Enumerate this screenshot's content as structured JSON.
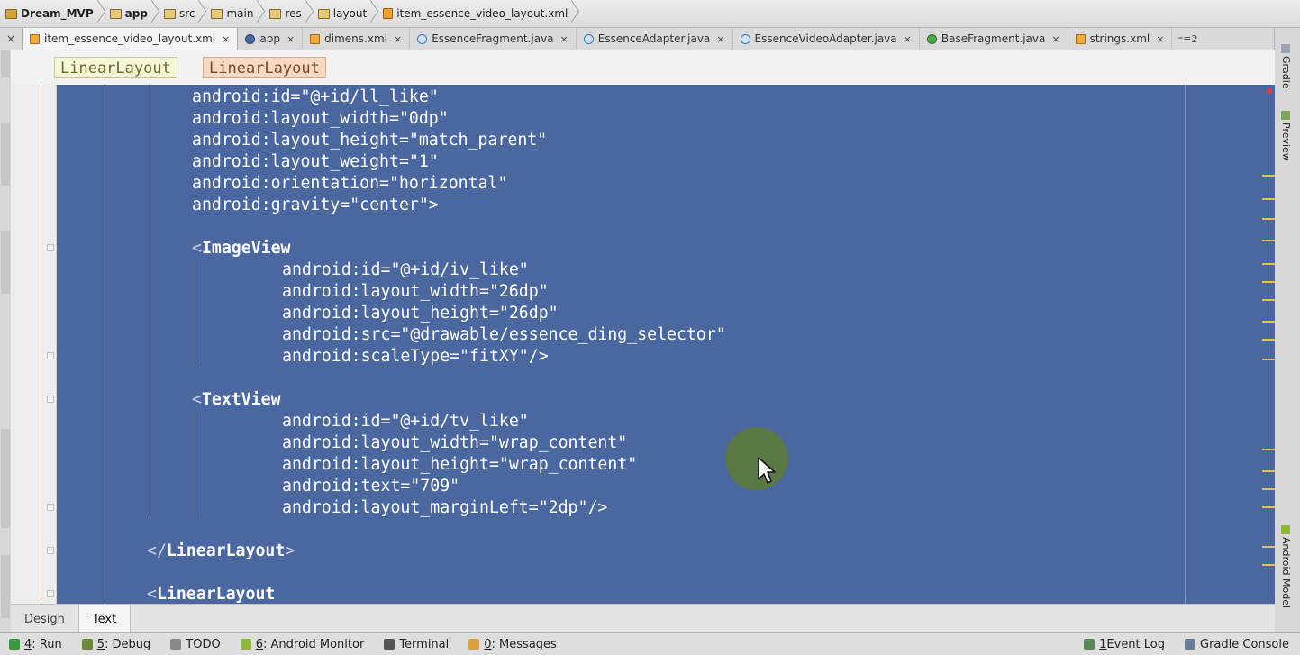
{
  "breadcrumb": [
    {
      "label": "Dream_MVP",
      "icon": "project-folder-icon",
      "bold": true
    },
    {
      "label": "app",
      "icon": "module-folder-icon",
      "bold": true
    },
    {
      "label": "src",
      "icon": "folder-icon",
      "bold": false
    },
    {
      "label": "main",
      "icon": "folder-icon",
      "bold": false
    },
    {
      "label": "res",
      "icon": "folder-icon",
      "bold": false
    },
    {
      "label": "layout",
      "icon": "folder-icon",
      "bold": false
    },
    {
      "label": "item_essence_video_layout.xml",
      "icon": "xml-file-icon",
      "bold": false
    }
  ],
  "tabs": [
    {
      "label": "item_essence_video_layout.xml",
      "type": "xml",
      "active": true
    },
    {
      "label": "app",
      "type": "app",
      "active": false
    },
    {
      "label": "dimens.xml",
      "type": "xml",
      "active": false
    },
    {
      "label": "EssenceFragment.java",
      "type": "class",
      "active": false
    },
    {
      "label": "EssenceAdapter.java",
      "type": "class",
      "active": false
    },
    {
      "label": "EssenceVideoAdapter.java",
      "type": "class",
      "active": false
    },
    {
      "label": "BaseFragment.java",
      "type": "base",
      "active": false
    },
    {
      "label": "strings.xml",
      "type": "xml",
      "active": false
    }
  ],
  "tab_close_glyph": "×",
  "tab_overflow": "⁼≡2",
  "tag_path": [
    "LinearLayout",
    "LinearLayout"
  ],
  "code_lines": [
    {
      "indent": 6,
      "text": "android:id=\"@+id/ll_like\""
    },
    {
      "indent": 6,
      "text": "android:layout_width=\"0dp\""
    },
    {
      "indent": 6,
      "text": "android:layout_height=\"match_parent\""
    },
    {
      "indent": 6,
      "text": "android:layout_weight=\"1\""
    },
    {
      "indent": 6,
      "text": "android:orientation=\"horizontal\""
    },
    {
      "indent": 6,
      "text": "android:gravity=\"center\">"
    },
    {
      "indent": 0,
      "text": ""
    },
    {
      "indent": 6,
      "text": "<ImageView"
    },
    {
      "indent": 10,
      "text": "android:id=\"@+id/iv_like\""
    },
    {
      "indent": 10,
      "text": "android:layout_width=\"26dp\""
    },
    {
      "indent": 10,
      "text": "android:layout_height=\"26dp\""
    },
    {
      "indent": 10,
      "text": "android:src=\"@drawable/essence_ding_selector\""
    },
    {
      "indent": 10,
      "text": "android:scaleType=\"fitXY\"/>"
    },
    {
      "indent": 0,
      "text": ""
    },
    {
      "indent": 6,
      "text": "<TextView"
    },
    {
      "indent": 10,
      "text": "android:id=\"@+id/tv_like\""
    },
    {
      "indent": 10,
      "text": "android:layout_width=\"wrap_content\""
    },
    {
      "indent": 10,
      "text": "android:layout_height=\"wrap_content\""
    },
    {
      "indent": 10,
      "text": "android:text=\"709\""
    },
    {
      "indent": 10,
      "text": "android:layout_marginLeft=\"2dp\"/>"
    },
    {
      "indent": 0,
      "text": ""
    },
    {
      "indent": 4,
      "text": "</LinearLayout>"
    },
    {
      "indent": 0,
      "text": ""
    },
    {
      "indent": 4,
      "text": "<LinearLayout"
    }
  ],
  "editor_tabs": [
    {
      "label": "Design",
      "active": false
    },
    {
      "label": "Text",
      "active": true
    }
  ],
  "right_panels": [
    "Gradle",
    "Preview",
    "Android Model"
  ],
  "bottom_tools_left": [
    {
      "key": "4",
      "label": ": Run",
      "icon": "run-icon",
      "color": "#3b9a3b"
    },
    {
      "key": "5",
      "label": ": Debug",
      "icon": "debug-icon",
      "color": "#6a8a3a"
    },
    {
      "key": "",
      "label": "TODO",
      "icon": "todo-icon",
      "color": "#8a8a8a"
    },
    {
      "key": "6",
      "label": ": Android Monitor",
      "icon": "android-icon",
      "color": "#8fb83b"
    },
    {
      "key": "",
      "label": "Terminal",
      "icon": "terminal-icon",
      "color": "#555555"
    },
    {
      "key": "0",
      "label": ": Messages",
      "icon": "messages-icon",
      "color": "#d9a23a"
    }
  ],
  "bottom_tools_right": [
    {
      "key": "1",
      "label": "Event Log",
      "icon": "event-log-icon",
      "color": "#5a8a5a"
    },
    {
      "key": "",
      "label": "Gradle Console",
      "icon": "gradle-console-icon",
      "color": "#6a7a9a"
    }
  ],
  "colors": {
    "selection": "#4a67a0",
    "cursor_halo": "#5a7a3c",
    "marker": "#e6c44a"
  }
}
